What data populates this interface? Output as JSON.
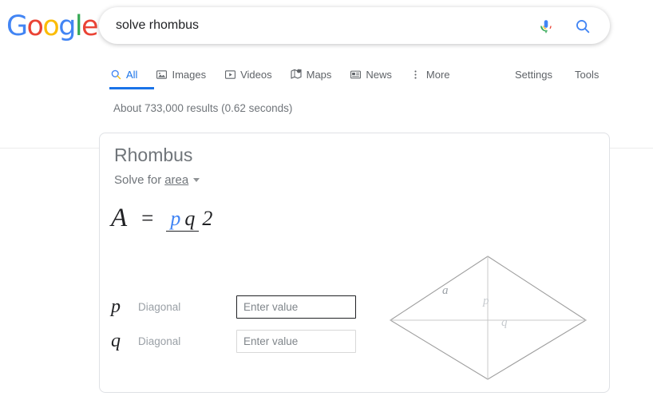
{
  "header": {
    "logo": {
      "name": "Google",
      "letters": [
        {
          "char": "G",
          "color": "#4285f4"
        },
        {
          "char": "o",
          "color": "#ea4335"
        },
        {
          "char": "o",
          "color": "#fbbc05"
        },
        {
          "char": "g",
          "color": "#4285f4"
        },
        {
          "char": "l",
          "color": "#34a853"
        },
        {
          "char": "e",
          "color": "#ea4335"
        }
      ]
    },
    "search": {
      "value": "solve rhombus",
      "placeholder": "Search",
      "mic_icon": "microphone-icon",
      "search_icon": "search-icon"
    }
  },
  "nav": {
    "tabs": [
      {
        "label": "All",
        "icon": "search-icon",
        "active": true
      },
      {
        "label": "Images",
        "icon": "image-icon",
        "active": false
      },
      {
        "label": "Videos",
        "icon": "video-icon",
        "active": false
      },
      {
        "label": "Maps",
        "icon": "map-pin-icon",
        "active": false
      },
      {
        "label": "News",
        "icon": "newspaper-icon",
        "active": false
      },
      {
        "label": "More",
        "icon": "kebab-menu-icon",
        "active": false
      }
    ],
    "right_links": [
      {
        "label": "Settings"
      },
      {
        "label": "Tools"
      }
    ]
  },
  "result_stats": "About 733,000 results (0.62 seconds)",
  "calculator": {
    "title": "Rhombus",
    "solve_for_label": "Solve for",
    "solve_for_value": "area",
    "caret_icon": "chevron-down-icon",
    "formula": {
      "lhs": "A",
      "equals": "=",
      "numerator_p": "p",
      "numerator_q": "q",
      "denominator": "2",
      "highlight_color": "#4285f4",
      "text_color": "#202124"
    },
    "variables": [
      {
        "symbol": "p",
        "name": "Diagonal",
        "value": "",
        "placeholder": "Enter value",
        "focused": true
      },
      {
        "symbol": "q",
        "name": "Diagonal",
        "value": "",
        "placeholder": "Enter value",
        "focused": false
      }
    ],
    "diagram": {
      "name": "rhombus-diagram",
      "side_label": "a",
      "vertical_diagonal_label": "p",
      "horizontal_diagonal_label": "q",
      "outline_color": "#9e9e9e",
      "diagonal_color": "#c4c4c4",
      "label_color": "#c6cace",
      "side_label_color": "#9aa0a6"
    }
  },
  "colors": {
    "google_blue": "#1a73e8",
    "accent_blue": "#4285f4",
    "red": "#ea4335",
    "yellow": "#fbbc05",
    "green": "#34a853",
    "text_gray": "#70757a",
    "border_gray": "#dfe1e5"
  }
}
